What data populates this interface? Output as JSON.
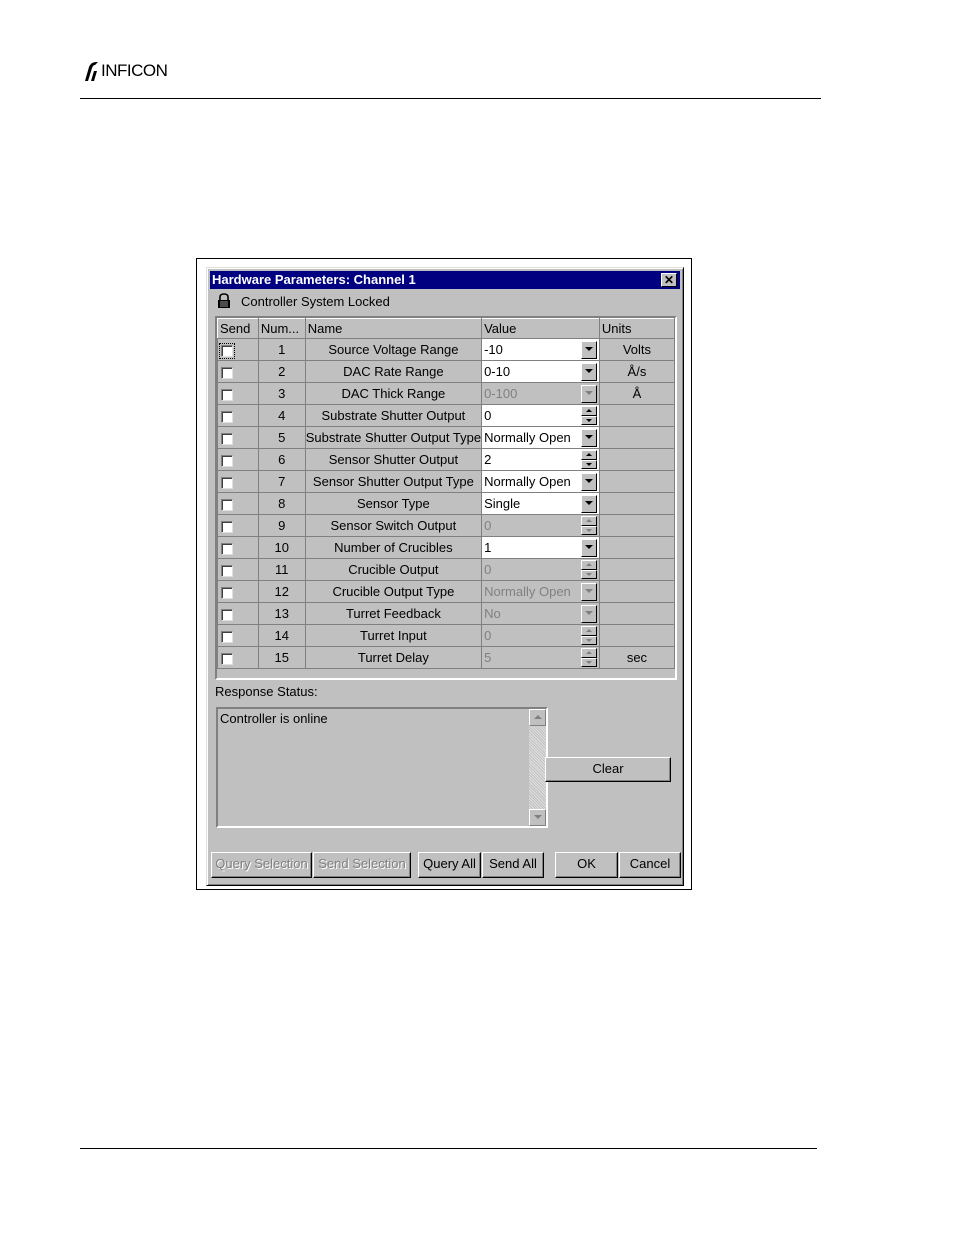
{
  "header": {
    "logo_text": "INFICON"
  },
  "dialog": {
    "title": "Hardware Parameters: Channel 1",
    "lock_status": "Controller System Locked",
    "columns": [
      "Send",
      "Num...",
      "Name",
      "Value",
      "Units"
    ],
    "rows": [
      {
        "num": "1",
        "name": "Source Voltage Range",
        "value": "-10",
        "units": "Volts",
        "control": "dropdown",
        "enabled": true
      },
      {
        "num": "2",
        "name": "DAC Rate Range",
        "value": "0-10",
        "units": "Å/s",
        "control": "dropdown",
        "enabled": true
      },
      {
        "num": "3",
        "name": "DAC Thick Range",
        "value": "0-100",
        "units": "Å",
        "control": "dropdown",
        "enabled": false
      },
      {
        "num": "4",
        "name": "Substrate Shutter Output",
        "value": "0",
        "units": "",
        "control": "spinner",
        "enabled": true
      },
      {
        "num": "5",
        "name": "Substrate Shutter Output Type",
        "value": "Normally Open",
        "units": "",
        "control": "dropdown",
        "enabled": true
      },
      {
        "num": "6",
        "name": "Sensor Shutter Output",
        "value": "2",
        "units": "",
        "control": "spinner",
        "enabled": true
      },
      {
        "num": "7",
        "name": "Sensor Shutter Output Type",
        "value": "Normally Open",
        "units": "",
        "control": "dropdown",
        "enabled": true
      },
      {
        "num": "8",
        "name": "Sensor Type",
        "value": "Single",
        "units": "",
        "control": "dropdown",
        "enabled": true
      },
      {
        "num": "9",
        "name": "Sensor Switch Output",
        "value": "0",
        "units": "",
        "control": "spinner",
        "enabled": false
      },
      {
        "num": "10",
        "name": "Number of Crucibles",
        "value": "1",
        "units": "",
        "control": "dropdown",
        "enabled": true
      },
      {
        "num": "11",
        "name": "Crucible Output",
        "value": "0",
        "units": "",
        "control": "spinner",
        "enabled": false
      },
      {
        "num": "12",
        "name": "Crucible Output Type",
        "value": "Normally Open",
        "units": "",
        "control": "dropdown",
        "enabled": false
      },
      {
        "num": "13",
        "name": "Turret Feedback",
        "value": "No",
        "units": "",
        "control": "dropdown",
        "enabled": false
      },
      {
        "num": "14",
        "name": "Turret Input",
        "value": "0",
        "units": "",
        "control": "spinner",
        "enabled": false
      },
      {
        "num": "15",
        "name": "Turret Delay",
        "value": "5",
        "units": "sec",
        "control": "spinner",
        "enabled": false
      }
    ],
    "response_label": "Response Status:",
    "response_text": "Controller is online",
    "clear_label": "Clear",
    "buttons": {
      "query_selection": "Query Selection",
      "send_selection": "Send Selection",
      "query_all": "Query All",
      "send_all": "Send All",
      "ok": "OK",
      "cancel": "Cancel"
    }
  },
  "colors": {
    "titlebar": "#000080",
    "face": "#c0c0c0",
    "disabled_text": "#808080"
  }
}
